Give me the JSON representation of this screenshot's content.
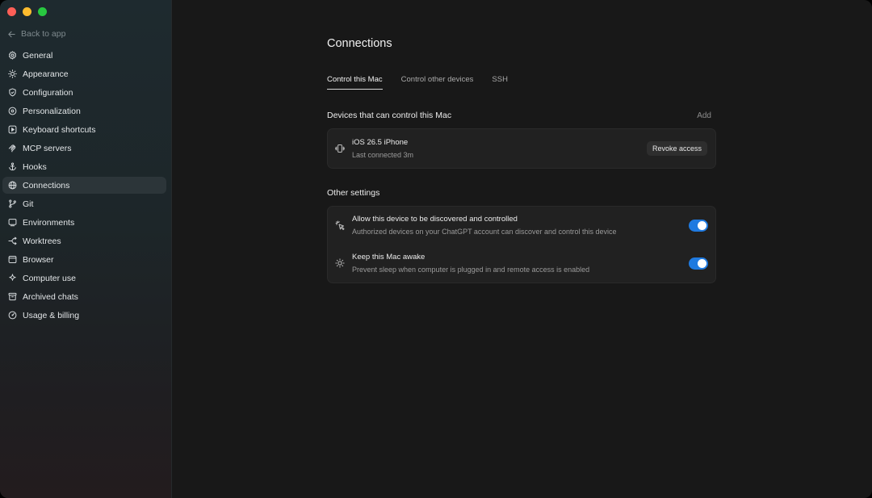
{
  "sidebar": {
    "back_label": "Back to app",
    "items": [
      {
        "label": "General",
        "icon": "gear-icon",
        "active": false
      },
      {
        "label": "Appearance",
        "icon": "sun-icon",
        "active": false
      },
      {
        "label": "Configuration",
        "icon": "shield-icon",
        "active": false
      },
      {
        "label": "Personalization",
        "icon": "palette-icon",
        "active": false
      },
      {
        "label": "Keyboard shortcuts",
        "icon": "keyboard-icon",
        "active": false
      },
      {
        "label": "MCP servers",
        "icon": "mcp-icon",
        "active": false
      },
      {
        "label": "Hooks",
        "icon": "anchor-icon",
        "active": false
      },
      {
        "label": "Connections",
        "icon": "globe-icon",
        "active": true
      },
      {
        "label": "Git",
        "icon": "git-branch-icon",
        "active": false
      },
      {
        "label": "Environments",
        "icon": "monitor-icon",
        "active": false
      },
      {
        "label": "Worktrees",
        "icon": "worktree-icon",
        "active": false
      },
      {
        "label": "Browser",
        "icon": "browser-icon",
        "active": false
      },
      {
        "label": "Computer use",
        "icon": "sparkle-cursor-icon",
        "active": false
      },
      {
        "label": "Archived chats",
        "icon": "archive-icon",
        "active": false
      },
      {
        "label": "Usage & billing",
        "icon": "gauge-icon",
        "active": false
      }
    ]
  },
  "main": {
    "title": "Connections",
    "tabs": [
      {
        "label": "Control this Mac",
        "active": true
      },
      {
        "label": "Control other devices",
        "active": false
      },
      {
        "label": "SSH",
        "active": false
      }
    ],
    "devices_section": {
      "title": "Devices that can control this Mac",
      "add_label": "Add",
      "devices": [
        {
          "name": "iOS 26.5 iPhone",
          "last_connected": "Last connected 3m",
          "action_label": "Revoke access",
          "icon": "phone-vibrate-icon"
        }
      ]
    },
    "other_section": {
      "title": "Other settings",
      "settings": [
        {
          "title": "Allow this device to be discovered and controlled",
          "description": "Authorized devices on your ChatGPT account can discover and control this device",
          "enabled": true,
          "icon": "cursor-click-icon"
        },
        {
          "title": "Keep this Mac awake",
          "description": "Prevent sleep when computer is plugged in and remote access is enabled",
          "enabled": true,
          "icon": "sun-icon"
        }
      ]
    }
  },
  "colors": {
    "accent": "#1f7ae0",
    "window_close": "#fe5f57",
    "window_minimize": "#febc2e",
    "window_maximize": "#28c840"
  }
}
